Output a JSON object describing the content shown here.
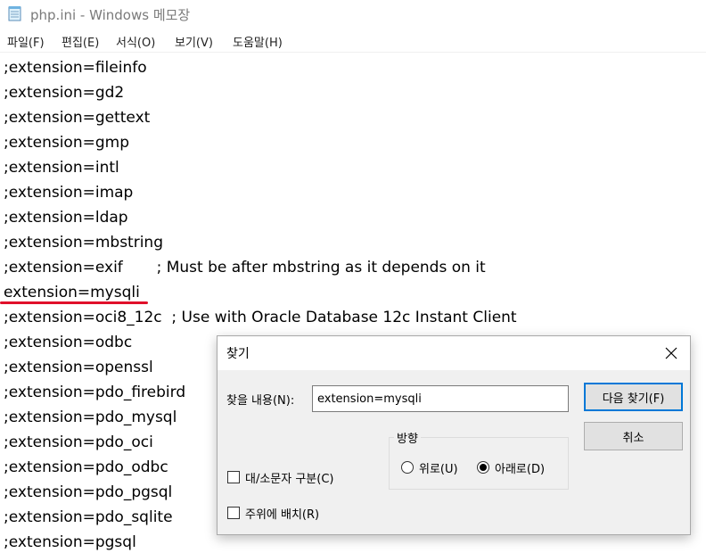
{
  "window": {
    "title": "php.ini - Windows 메모장"
  },
  "menu": [
    "파일(F)",
    "편집(E)",
    "서식(O)",
    "보기(V)",
    "도움말(H)"
  ],
  "editor": {
    "lines": [
      ";extension=fileinfo",
      ";extension=gd2",
      ";extension=gettext",
      ";extension=gmp",
      ";extension=intl",
      ";extension=imap",
      ";extension=ldap",
      ";extension=mbstring",
      ";extension=exif       ; Must be after mbstring as it depends on it",
      "extension=mysqli",
      ";extension=oci8_12c  ; Use with Oracle Database 12c Instant Client",
      ";extension=odbc",
      ";extension=openssl",
      ";extension=pdo_firebird",
      ";extension=pdo_mysql",
      ";extension=pdo_oci",
      ";extension=pdo_odbc",
      ";extension=pdo_pgsql",
      ";extension=pdo_sqlite",
      ";extension=pgsql"
    ],
    "annotation_color": "#e0102a"
  },
  "find_dialog": {
    "title": "찾기",
    "find_label": "찾을 내용(N):",
    "find_value": "extension=mysqli",
    "find_next_label": "다음 찾기(F)",
    "cancel_label": "취소",
    "direction_label": "방향",
    "up_label": "위로(U)",
    "down_label": "아래로(D)",
    "selected_direction": "down",
    "match_case_label": "대/소문자 구분(C)",
    "match_case_checked": false,
    "wrap_label": "주위에 배치(R)",
    "wrap_checked": false,
    "accent_color": "#0078d7"
  }
}
